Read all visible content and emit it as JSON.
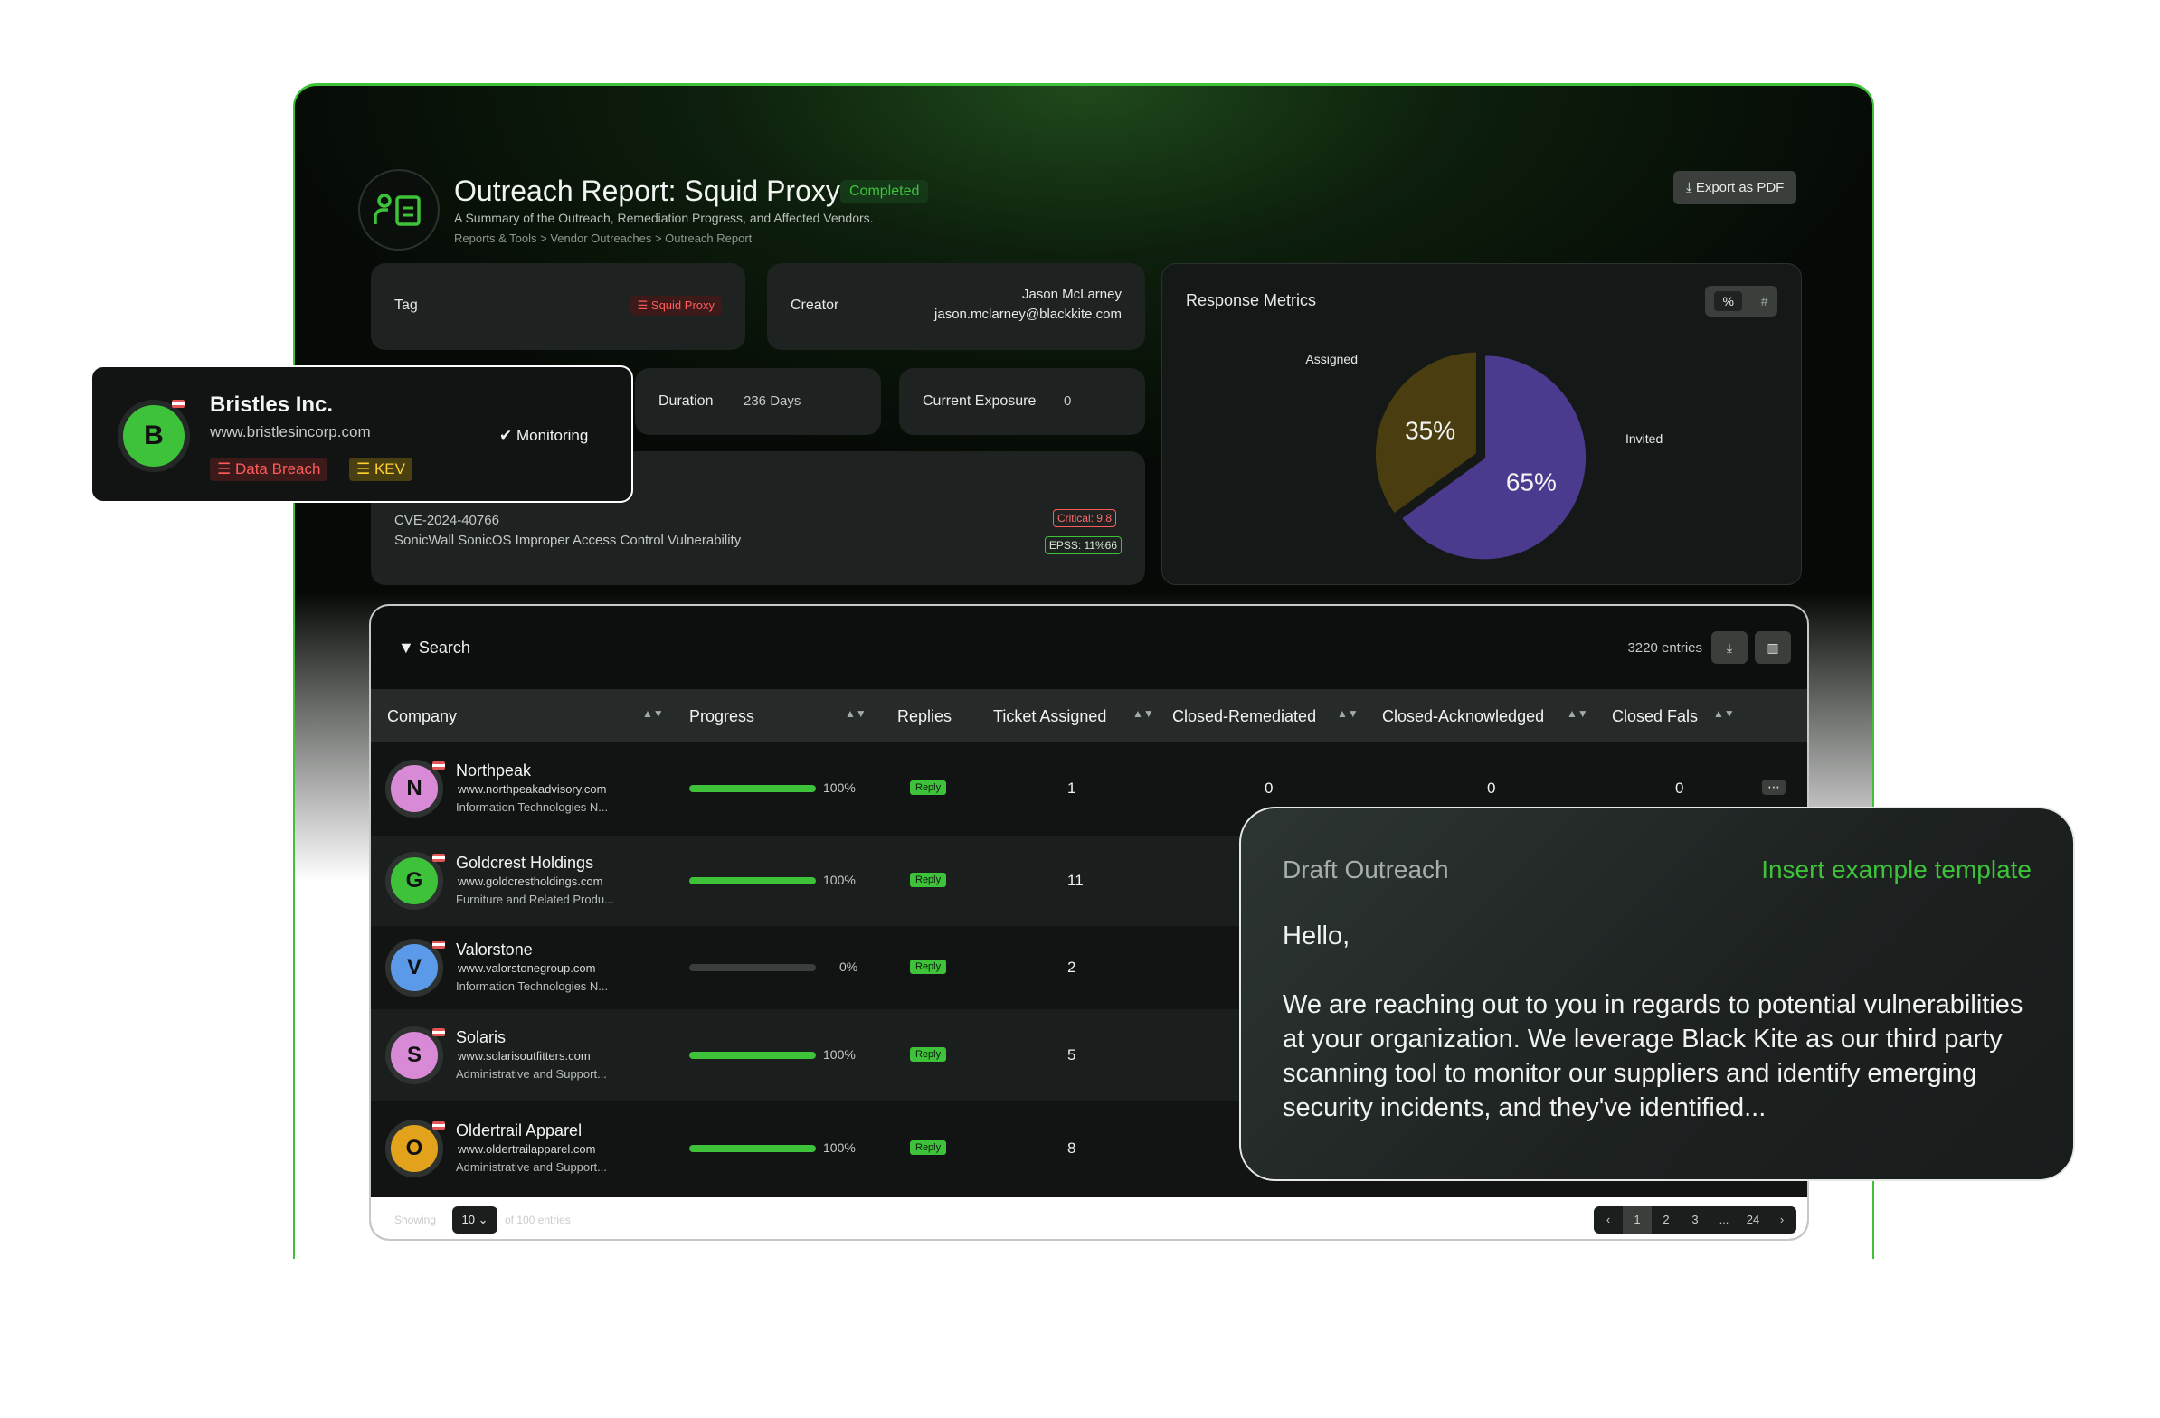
{
  "header": {
    "title": "Outreach Report: Squid Proxy",
    "status": "Completed",
    "subtitle": "A Summary of the Outreach, Remediation Progress, and Affected Vendors.",
    "breadcrumb": "Reports & Tools > Vendor Outreaches > Outreach Report",
    "export_label": "Export as PDF"
  },
  "info": {
    "tag_label": "Tag",
    "tag_value": "Squid Proxy",
    "creator_label": "Creator",
    "creator_name": "Jason McLarney",
    "creator_email": "jason.mclarney@blackkite.com",
    "duration_label": "Duration",
    "duration_value": "236 Days",
    "exposure_label": "Current Exposure",
    "exposure_value": "0",
    "cve_id": "CVE-2024-40766",
    "cve_desc": "SonicWall SonicOS Improper Access Control Vulnerability",
    "critical": "Critical: 9.8",
    "epss": "EPSS: 11%66"
  },
  "metrics": {
    "title": "Response Metrics",
    "toggle_pct": "%",
    "toggle_num": "#"
  },
  "chart_data": {
    "type": "pie",
    "categories": [
      "Assigned",
      "Invited"
    ],
    "values": [
      35,
      65
    ],
    "labels": [
      "35%",
      "65%"
    ],
    "colors": [
      "#4a3d10",
      "#4b3a8e"
    ]
  },
  "table": {
    "search_label": "Search",
    "entries": "3220 entries",
    "columns": [
      "Company",
      "Progress",
      "Replies",
      "Ticket Assigned",
      "Closed-Remediated",
      "Closed-Acknowledged",
      "Closed Fals"
    ],
    "rows": [
      {
        "initial": "N",
        "name": "Northpeak",
        "site": "www.northpeakadvisory.com",
        "industry": "Information Technologies N...",
        "progress": "100%",
        "reply": "Reply",
        "tickets": "1",
        "remediated": "0",
        "acknowledged": "0",
        "false": "0",
        "color": "#d98ad6",
        "progress_value": 1.0
      },
      {
        "initial": "G",
        "name": "Goldcrest Holdings",
        "site": "www.goldcrestholdings.com",
        "industry": "Furniture and Related Produ...",
        "progress": "100%",
        "reply": "Reply",
        "tickets": "11",
        "color": "#3ec23a",
        "progress_value": 1.0
      },
      {
        "initial": "V",
        "name": "Valorstone",
        "site": "www.valorstonegroup.com",
        "industry": "Information Technologies N...",
        "progress": "0%",
        "reply": "Reply",
        "tickets": "2",
        "color": "#5a9ae8",
        "progress_value": 0.0
      },
      {
        "initial": "S",
        "name": "Solaris",
        "site": "www.solarisoutfitters.com",
        "industry": "Administrative and Support...",
        "progress": "100%",
        "reply": "Reply",
        "tickets": "5",
        "color": "#d98ad6",
        "progress_value": 1.0
      },
      {
        "initial": "O",
        "name": "Oldertrail Apparel",
        "site": "www.oldertrailapparel.com",
        "industry": "Administrative and Support...",
        "progress": "100%",
        "reply": "Reply",
        "tickets": "8",
        "color": "#e2a21c",
        "progress_value": 1.0
      }
    ],
    "showing_label": "Showing",
    "page_size": "10",
    "of_label": "of 100 entries",
    "pages": [
      "1",
      "2",
      "3",
      "...",
      "24"
    ]
  },
  "vendor_popup": {
    "initial": "B",
    "name": "Bristles Inc.",
    "site": "www.bristlesincorp.com",
    "status": "Monitoring",
    "tag1": "Data Breach",
    "tag2": "KEV"
  },
  "draft": {
    "title": "Draft Outreach",
    "insert_label": "Insert example template",
    "greeting": "Hello,",
    "body": "We are reaching out to you in regards to potential vulnerabilities at your organization. We leverage Black Kite as our third party scanning tool to monitor our suppliers and identify emerging security incidents, and they've identified..."
  }
}
